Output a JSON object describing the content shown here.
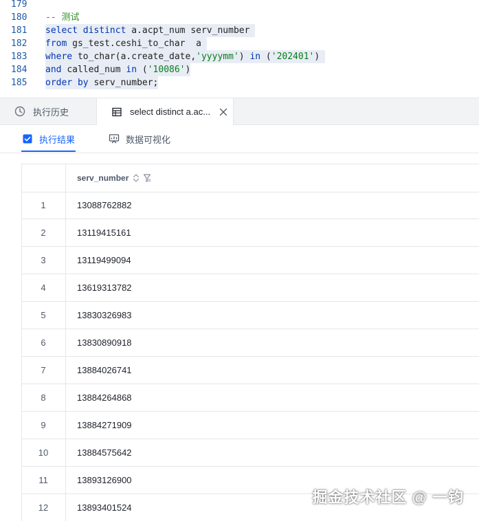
{
  "editor": {
    "lines": [
      {
        "num": "179",
        "tokens": []
      },
      {
        "num": "180",
        "tokens": [
          {
            "t": "-- 测试",
            "c": "cmt"
          }
        ]
      },
      {
        "num": "181",
        "hl": true,
        "tokens": [
          {
            "t": "select distinct ",
            "c": "kw"
          },
          {
            "t": "a.acpt_num serv_number ",
            "c": "plain"
          }
        ]
      },
      {
        "num": "182",
        "hl": true,
        "tokens": [
          {
            "t": "from ",
            "c": "kw"
          },
          {
            "t": "gs_test.ceshi_to_char  a ",
            "c": "plain"
          }
        ]
      },
      {
        "num": "183",
        "hl": true,
        "tokens": [
          {
            "t": "where ",
            "c": "kw"
          },
          {
            "t": "to_char(a.create_date,",
            "c": "plain"
          },
          {
            "t": "'yyyymm'",
            "c": "str"
          },
          {
            "t": ") ",
            "c": "plain"
          },
          {
            "t": "in ",
            "c": "kw"
          },
          {
            "t": "(",
            "c": "plain"
          },
          {
            "t": "'202401'",
            "c": "str"
          },
          {
            "t": ") ",
            "c": "plain"
          }
        ]
      },
      {
        "num": "184",
        "hl": true,
        "tokens": [
          {
            "t": "and ",
            "c": "kw"
          },
          {
            "t": "called_num ",
            "c": "plain"
          },
          {
            "t": "in ",
            "c": "kw"
          },
          {
            "t": "(",
            "c": "plain"
          },
          {
            "t": "'10086'",
            "c": "str"
          },
          {
            "t": ")",
            "c": "plain"
          }
        ]
      },
      {
        "num": "185",
        "hl": true,
        "tokens": [
          {
            "t": "order by ",
            "c": "kw"
          },
          {
            "t": "serv_number;",
            "c": "plain"
          }
        ]
      }
    ]
  },
  "tabs": {
    "history_label": "执行历史",
    "active_label": "select distinct a.ac..."
  },
  "subtabs": {
    "result_label": "执行结果",
    "viz_label": "数据可视化"
  },
  "table": {
    "column": "serv_number",
    "rows": [
      {
        "idx": "1",
        "value": "13088762882"
      },
      {
        "idx": "2",
        "value": "13119415161"
      },
      {
        "idx": "3",
        "value": "13119499094"
      },
      {
        "idx": "4",
        "value": "13619313782"
      },
      {
        "idx": "5",
        "value": "13830326983"
      },
      {
        "idx": "6",
        "value": "13830890918"
      },
      {
        "idx": "7",
        "value": "13884026741"
      },
      {
        "idx": "8",
        "value": "13884264868"
      },
      {
        "idx": "9",
        "value": "13884271909"
      },
      {
        "idx": "10",
        "value": "13884575642"
      },
      {
        "idx": "11",
        "value": "13893126900"
      },
      {
        "idx": "12",
        "value": "13893401524"
      }
    ]
  },
  "watermark": "掘金技术社区 @ 一钧",
  "colors": {
    "accent": "#1664ff",
    "keyword": "#0033b3",
    "string": "#067d17",
    "comment": "#2e8b20"
  }
}
